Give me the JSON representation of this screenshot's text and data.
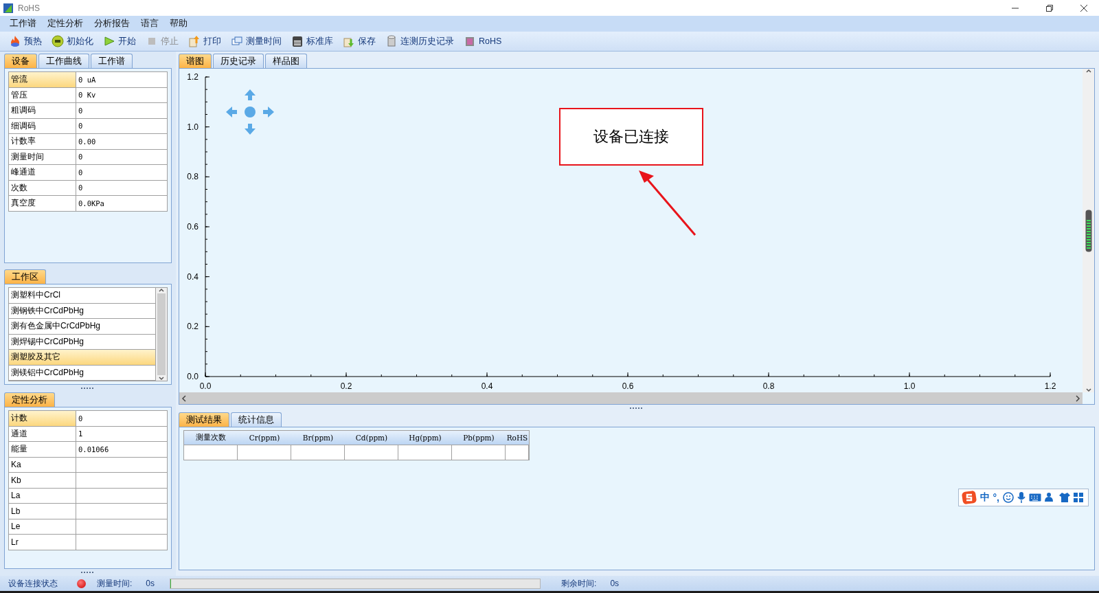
{
  "window": {
    "title": "RoHS"
  },
  "menu": [
    "工作谱",
    "定性分析",
    "分析报告",
    "语言",
    "帮助"
  ],
  "toolbar": [
    {
      "label": "预热",
      "disabled": false
    },
    {
      "label": "初始化",
      "disabled": false
    },
    {
      "label": "开始",
      "disabled": false
    },
    {
      "label": "停止",
      "disabled": true
    },
    {
      "label": "打印",
      "disabled": false
    },
    {
      "label": "测量时间",
      "disabled": false
    },
    {
      "label": "标准库",
      "disabled": false
    },
    {
      "label": "保存",
      "disabled": false
    },
    {
      "label": "连测历史记录",
      "disabled": false
    },
    {
      "label": "RoHS",
      "disabled": false
    }
  ],
  "left_tabs": [
    {
      "label": "设备",
      "selected": true
    },
    {
      "label": "工作曲线",
      "selected": false
    },
    {
      "label": "工作谱",
      "selected": false
    }
  ],
  "device_properties": [
    {
      "label": "管流",
      "value": "0 uA",
      "selected": true
    },
    {
      "label": "管压",
      "value": "0 Kv",
      "selected": false
    },
    {
      "label": "粗调码",
      "value": "0",
      "selected": false
    },
    {
      "label": "细调码",
      "value": "0",
      "selected": false
    },
    {
      "label": "计数率",
      "value": "0.00",
      "selected": false
    },
    {
      "label": "测量时间",
      "value": "0",
      "selected": false
    },
    {
      "label": "峰通道",
      "value": "0",
      "selected": false
    },
    {
      "label": "次数",
      "value": "0",
      "selected": false
    },
    {
      "label": "真空度",
      "value": "0.0KPa",
      "selected": false
    }
  ],
  "workspace": {
    "tab": "工作区",
    "items": [
      {
        "label": "测塑料中CrCl",
        "selected": false
      },
      {
        "label": "测钢铁中CrCdPbHg",
        "selected": false
      },
      {
        "label": "测有色金属中CrCdPbHg",
        "selected": false
      },
      {
        "label": "测焊锡中CrCdPbHg",
        "selected": false
      },
      {
        "label": "测塑胶及其它",
        "selected": true
      },
      {
        "label": "测镁铝中CrCdPbHg",
        "selected": false
      }
    ]
  },
  "qualitative": {
    "tab": "定性分析",
    "rows": [
      {
        "label": "计数",
        "value": "0",
        "selected": true
      },
      {
        "label": "通道",
        "value": "1",
        "selected": false
      },
      {
        "label": "能量",
        "value": "0.01066",
        "selected": false
      },
      {
        "label": "Ka",
        "selected": false
      },
      {
        "label": "Kb",
        "selected": false
      },
      {
        "label": "La",
        "selected": false
      },
      {
        "label": "Lb",
        "selected": false
      },
      {
        "label": "Le",
        "selected": false
      },
      {
        "label": "Lr",
        "selected": false
      }
    ]
  },
  "right_tabs": [
    {
      "label": "谱图",
      "selected": true
    },
    {
      "label": "历史记录",
      "selected": false
    },
    {
      "label": "样品图",
      "selected": false
    }
  ],
  "chart": {
    "annotation": "设备已连接",
    "chart_data": {
      "type": "line",
      "xlim": [
        0,
        1.2
      ],
      "ylim": [
        0,
        1.2
      ],
      "xticks": [
        {
          "value": 0,
          "label": "0.0"
        },
        {
          "value": 0.2,
          "label": "0.2"
        },
        {
          "value": 0.4,
          "label": "0.4"
        },
        {
          "value": 0.6,
          "label": "0.6"
        },
        {
          "value": 0.8,
          "label": "0.8"
        },
        {
          "value": 1,
          "label": "1.0"
        },
        {
          "value": 1.2,
          "label": "1.2"
        }
      ],
      "yticks": [
        {
          "value": 0,
          "label": "0.0"
        },
        {
          "value": 0.2,
          "label": "0.2"
        },
        {
          "value": 0.4,
          "label": "0.4"
        },
        {
          "value": 0.6,
          "label": "0.6"
        },
        {
          "value": 0.8,
          "label": "0.8"
        },
        {
          "value": 1,
          "label": "1.0"
        },
        {
          "value": 1.2,
          "label": "1.2"
        }
      ]
    }
  },
  "result_tabs": [
    {
      "label": "测试结果",
      "selected": true
    },
    {
      "label": "统计信息",
      "selected": false
    }
  ],
  "results_table": {
    "columns": [
      "测量次数",
      "Cr(ppm)",
      "Br(ppm)",
      "Cd(ppm)",
      "Hg(ppm)",
      "Pb(ppm)",
      "RoHS"
    ]
  },
  "ime_toolbar": {
    "mode": "中",
    "punctuation": "°,"
  },
  "status_bar": {
    "connection_label": "设备连接状态",
    "connected": false,
    "time_label": "测量时间:",
    "time_value": "0s",
    "progress": {
      "level": 0
    },
    "remaining_label": "剩余时间:",
    "remaining_value": "0s"
  }
}
